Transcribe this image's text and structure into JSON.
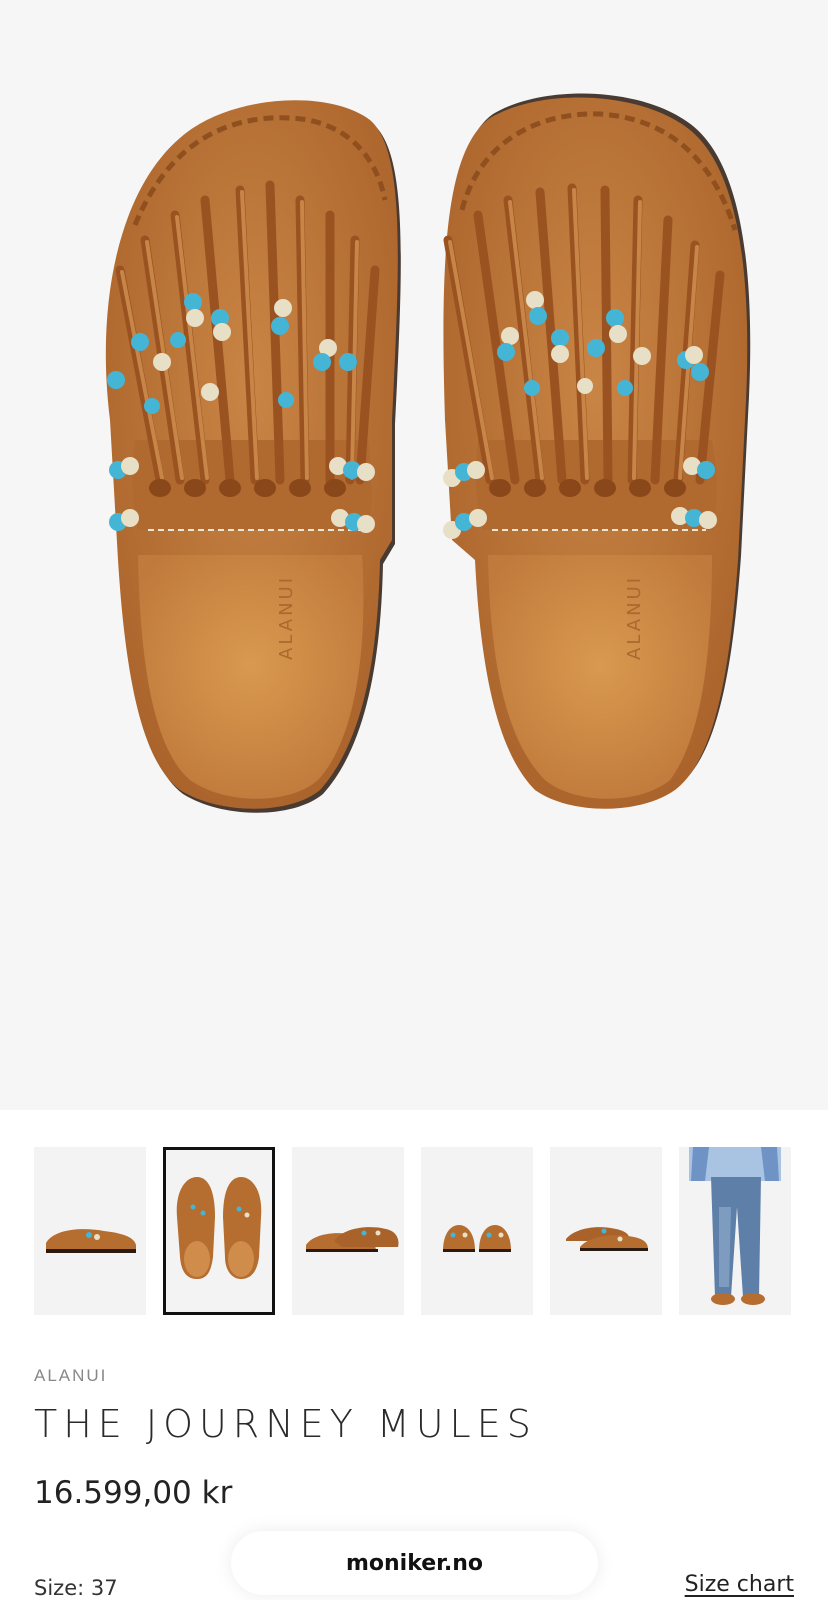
{
  "gallery": {
    "main_image_alt": "ALANUI fringed beaded suede mules, top view",
    "insole_logo": "ALANUI",
    "thumbnails": [
      {
        "name": "side view"
      },
      {
        "name": "top view"
      },
      {
        "name": "angled pair"
      },
      {
        "name": "front view"
      },
      {
        "name": "side pair"
      },
      {
        "name": "model wearing"
      }
    ],
    "active_index": 1
  },
  "product": {
    "brand": "ALANUI",
    "title": "THE JOURNEY MULES",
    "price": "16.599,00 kr",
    "size_label": "Size:",
    "size_value": "37",
    "size_chart_label": "Size chart"
  },
  "browser": {
    "url": "moniker.no"
  },
  "colors": {
    "suede": "#c07a3c",
    "suede_dark": "#a9622a",
    "bead_turquoise": "#45b5d6",
    "bead_cream": "#e8dfc7",
    "background": "#f6f6f6"
  }
}
